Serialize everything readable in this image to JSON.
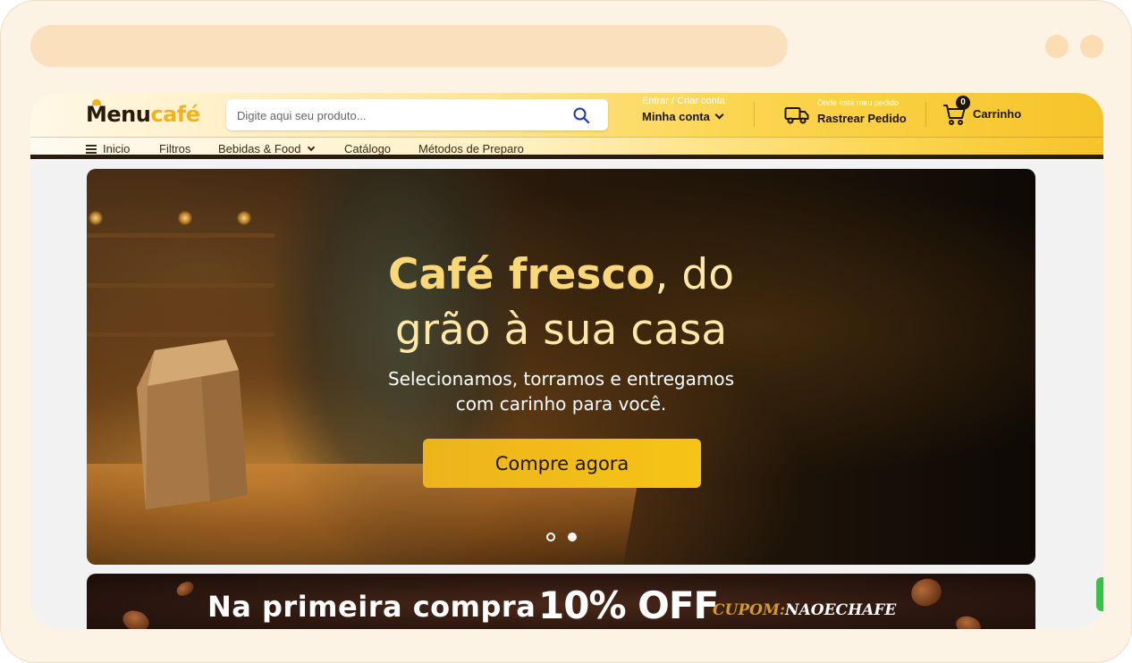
{
  "browser": {},
  "header": {
    "logo": {
      "part1": "Menu",
      "part2": "café"
    },
    "search": {
      "placeholder": "Digite aqui seu produto...",
      "icon": "search-icon"
    },
    "account": {
      "small": "Entrar / Criar conta",
      "big": "Minha conta"
    },
    "track": {
      "small": "Onde está meu pedido",
      "big": "Rastrear Pedido",
      "icon": "truck-icon"
    },
    "cart": {
      "count": "0",
      "label": "Carrinho",
      "icon": "cart-icon"
    }
  },
  "nav": {
    "items": [
      {
        "label": "Inicio",
        "icon": "menu-icon"
      },
      {
        "label": "Filtros"
      },
      {
        "label": "Bebidas & Food",
        "icon": "chevron-down-icon"
      },
      {
        "label": "Catálogo"
      },
      {
        "label": "Métodos de Preparo"
      }
    ]
  },
  "hero": {
    "title_bold": "Café fresco",
    "title_rest": ", do",
    "title_line2": "grão à sua casa",
    "subtitle_line1": "Selecionamos, torramos e entregamos",
    "subtitle_line2": "com carinho para você.",
    "cta": "Compre agora",
    "carousel": {
      "slides": 2,
      "active": 2
    }
  },
  "promo": {
    "text": "Na primeira compra",
    "discount": "10% OFF",
    "coupon_label": "CUPOM:",
    "coupon_code": "NAOECHAFE"
  },
  "colors": {
    "accent": "#f6c42a",
    "dark": "#1e1400",
    "promo_gold": "#d39b2a",
    "frame": "#fdf3e4"
  }
}
